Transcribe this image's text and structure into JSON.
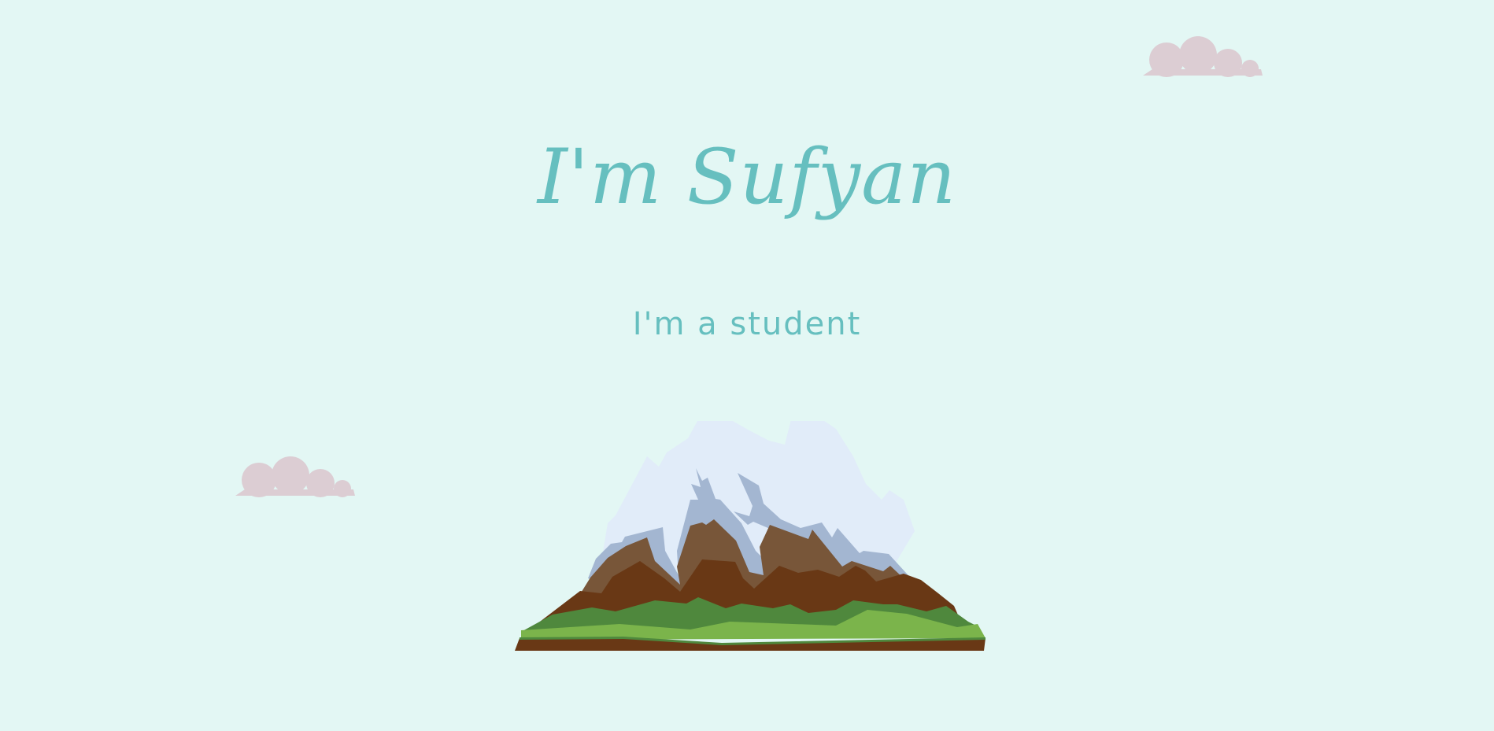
{
  "hero": {
    "title": "I'm Sufyan",
    "subtitle": "I'm a student"
  },
  "icons": {
    "top_cloud": "cloud-icon",
    "bottom_cloud": "cloud-icon",
    "mountain": "mountain-illustration"
  },
  "colors": {
    "background": "#e3f7f4",
    "accent": "#66bfbf",
    "cloud": "#dccdd3",
    "snow": "#e1ecf9",
    "rock_shadow": "#a3b6d1",
    "rock": "#785639",
    "soil": "#693815",
    "grass_dark": "#4f883d",
    "grass_light": "#7bb44b"
  }
}
